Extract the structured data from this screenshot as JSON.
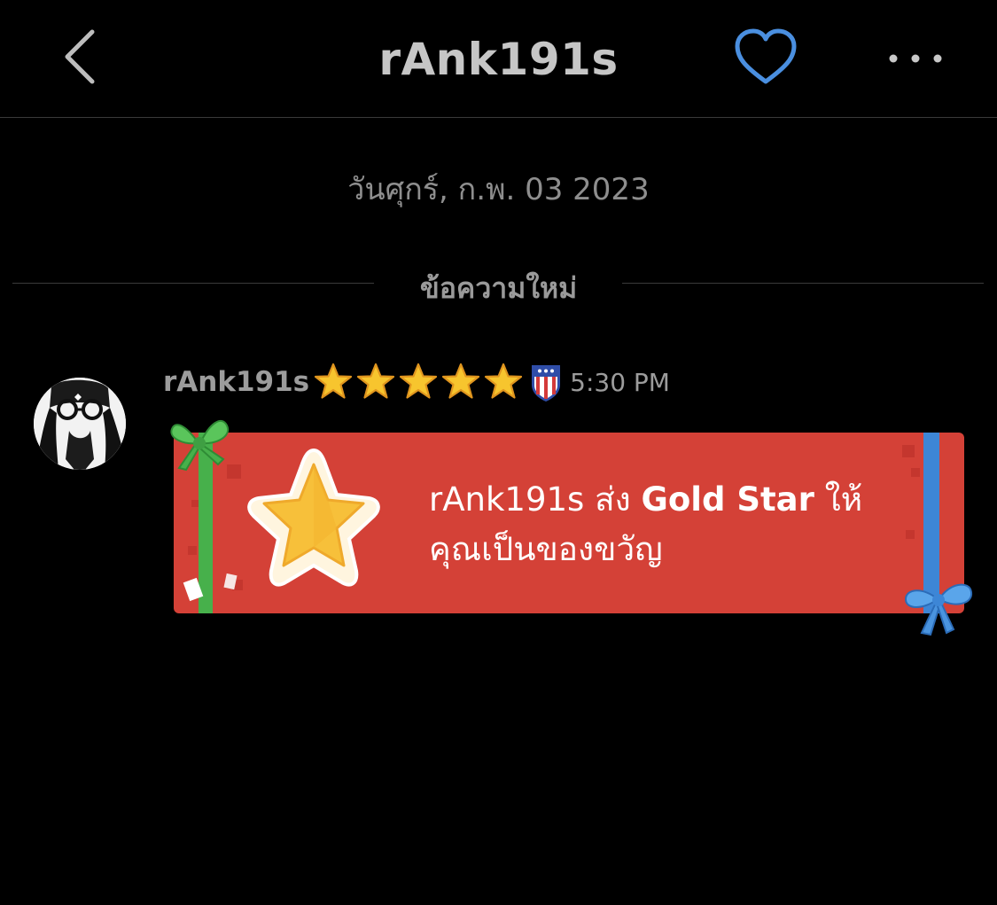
{
  "header": {
    "title": "rAnk191s"
  },
  "chat": {
    "date": "วันศุกร์, ก.พ. 03 2023",
    "new_messages_label": "ข้อความใหม่"
  },
  "message": {
    "username": "rAnk191s",
    "rank_stars": 5,
    "time": "5:30 PM",
    "gift": {
      "sender": "rAnk191s",
      "verb": "ส่ง",
      "item": "Gold Star",
      "suffix": "ให้",
      "line2": "คุณเป็นของขวัญ"
    }
  },
  "colors": {
    "background": "#000000",
    "heart_accent": "#4a8fe0",
    "gift_card": "#d44137",
    "star_gold": "#f7c52e",
    "ribbon_green": "#47b04b",
    "ribbon_blue": "#3d86d6"
  },
  "icons": {
    "back": "chevron-left-icon",
    "favorite": "heart-icon",
    "more": "more-dots-icon",
    "rank": "star-icon",
    "badge": "flag-shield-icon"
  }
}
